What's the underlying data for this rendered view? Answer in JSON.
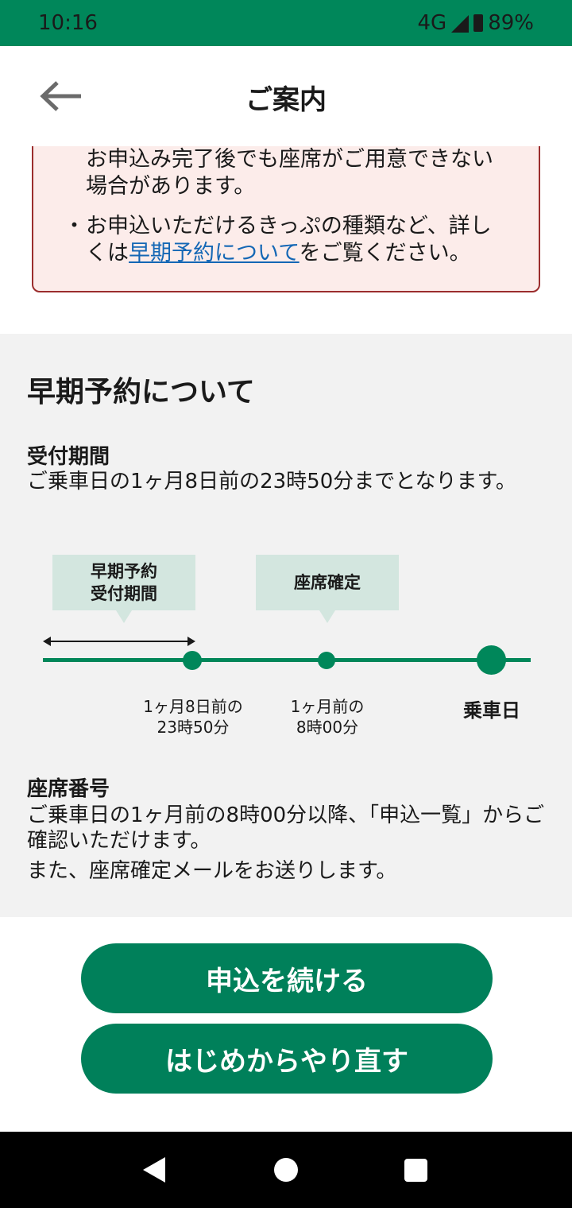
{
  "status_bar": {
    "time": "10:16",
    "network": "4G",
    "battery": "89%"
  },
  "app_bar": {
    "title": "ご案内",
    "back_icon": "arrow-left-icon"
  },
  "notice": {
    "line1": "お申込み完了後でも座席がご用意できない",
    "line2": "場合があります。",
    "bullet": "・",
    "line3": "お申込いただけるきっぷの種類など、詳し",
    "line4_prefix": "くは",
    "line4_link": "早期予約について",
    "line4_suffix": "をご覧ください。"
  },
  "early": {
    "title": "早期予約について",
    "period_heading": "受付期間",
    "period_text": "ご乗車日の1ヶ月8日前の23時50分までとなります。",
    "timeline": {
      "bubble1_line1": "早期予約",
      "bubble1_line2": "受付期間",
      "bubble2": "座席確定",
      "label1_line1": "1ヶ月8日前の",
      "label1_line2": "23時50分",
      "label2_line1": "1ヶ月前の",
      "label2_line2": "8時00分",
      "label3": "乗車日"
    },
    "seat_heading": "座席番号",
    "seat_text1": "ご乗車日の1ヶ月前の8時00分以降、「申込一覧」からご確認いただけます。",
    "seat_text2": "また、座席確定メールをお送りします。"
  },
  "buttons": {
    "continue": "申込を続ける",
    "restart": "はじめからやり直す"
  },
  "colors": {
    "brand": "#00875a",
    "notice_bg": "#fcecea",
    "notice_border": "#9b2d2d",
    "link": "#1467b5",
    "bubble": "#d3e6df"
  }
}
